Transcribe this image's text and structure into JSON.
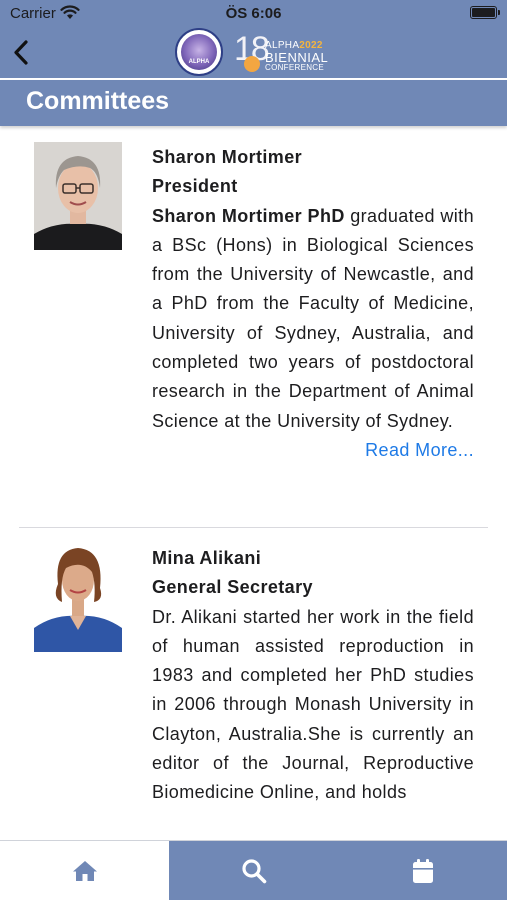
{
  "status_bar": {
    "carrier": "Carrier",
    "time": "ÖS 6:06",
    "battery_level": 1.0
  },
  "header": {
    "back_icon": "chevron-left-icon",
    "logo": {
      "seal_text": "ALPHA",
      "number": "18",
      "line1": "ALPHA",
      "year": "2022",
      "line2": "BIENNIAL",
      "line3": "CONFERENCE"
    }
  },
  "page": {
    "title": "Committees"
  },
  "members": [
    {
      "name": "Sharon Mortimer",
      "role": "President",
      "bio_lead": "Sharon Mortimer PhD",
      "bio_rest": " graduated with a BSc (Hons) in Biological Sciences from the University of Newcastle, and a PhD from the Faculty of Medicine, University of Sydney, Australia, and completed two years of postdoctoral research in the Department of Animal Science at the University of Sydney.",
      "read_more": "Read More..."
    },
    {
      "name": "Mina Alikani",
      "role": "General Secretary",
      "bio_lead": "",
      "bio_rest": "Dr. Alikani started her work in the field of human assisted reproduction in 1983 and completed her PhD studies in 2006 through Monash University in Clayton, Australia.She is currently an editor of the Journal, Reproductive Biomedicine Online, and holds",
      "read_more": ""
    }
  ],
  "tab_bar": {
    "tabs": [
      {
        "icon": "home-icon",
        "active": true
      },
      {
        "icon": "search-icon",
        "active": false
      },
      {
        "icon": "calendar-icon",
        "active": false
      }
    ]
  },
  "colors": {
    "header_bg": "#7088b6",
    "link": "#1e7ae6",
    "tab_icon_active": "#7088b6",
    "tab_icon_inactive": "#ffffff"
  }
}
